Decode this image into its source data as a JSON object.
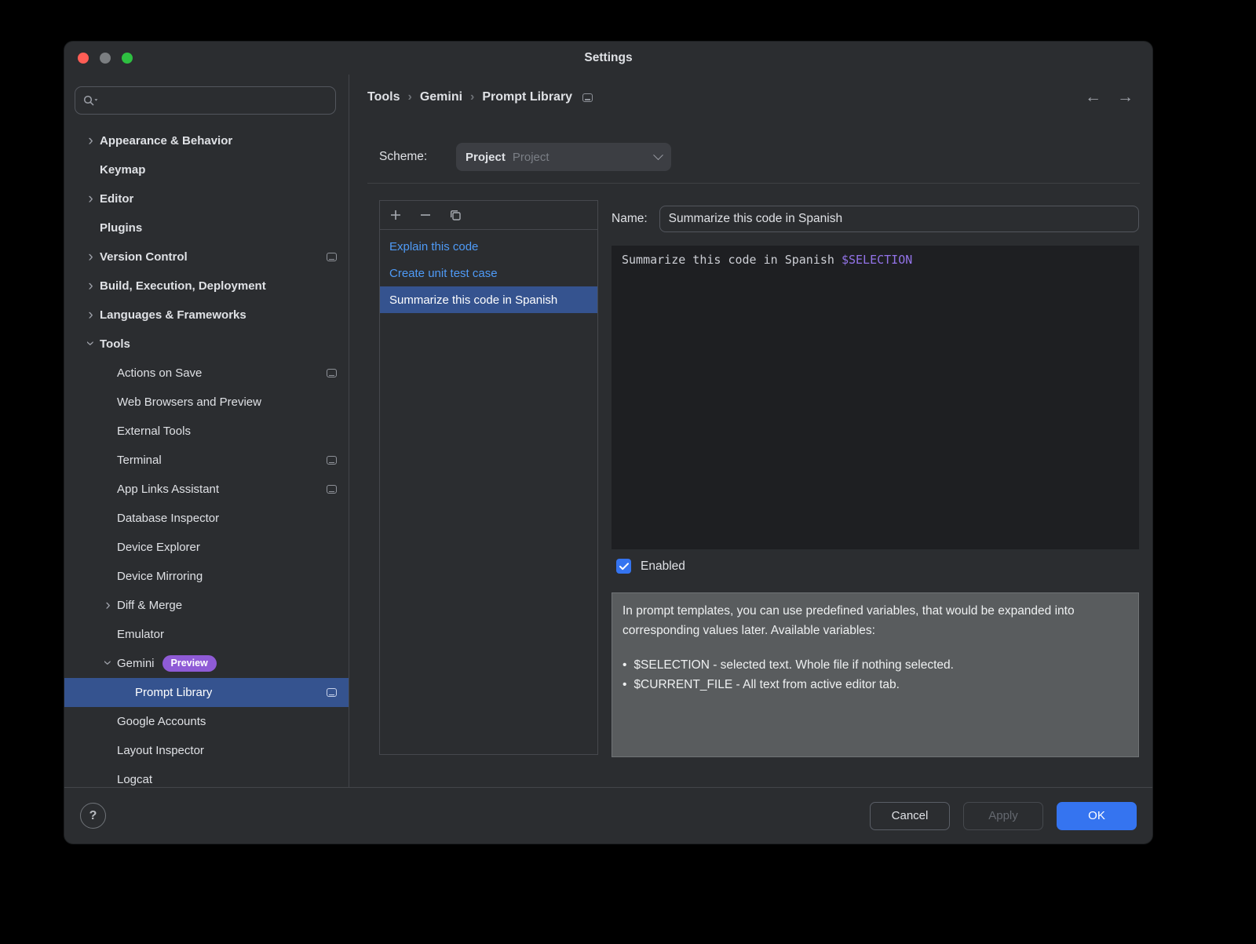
{
  "colors": {
    "accent": "#3574f0",
    "selection": "#35538f",
    "link": "#4f9bf7",
    "badge": "#8f5bd6",
    "variable": "#9373e8",
    "editor-bg": "#1e1f22",
    "info-bg": "#595c5e"
  },
  "window": {
    "title": "Settings"
  },
  "sidebar": {
    "search": {
      "placeholder": ""
    },
    "items": [
      {
        "label": "Appearance & Behavior",
        "level": 0,
        "chevron": "right",
        "bold": true
      },
      {
        "label": "Keymap",
        "level": 0,
        "bold": true
      },
      {
        "label": "Editor",
        "level": 0,
        "chevron": "right",
        "bold": true
      },
      {
        "label": "Plugins",
        "level": 0,
        "bold": true
      },
      {
        "label": "Version Control",
        "level": 0,
        "chevron": "right",
        "bold": true,
        "config_icon": true
      },
      {
        "label": "Build, Execution, Deployment",
        "level": 0,
        "chevron": "right",
        "bold": true
      },
      {
        "label": "Languages & Frameworks",
        "level": 0,
        "chevron": "right",
        "bold": true
      },
      {
        "label": "Tools",
        "level": 0,
        "chevron": "down",
        "bold": true
      },
      {
        "label": "Actions on Save",
        "level": 1,
        "config_icon": true
      },
      {
        "label": "Web Browsers and Preview",
        "level": 1
      },
      {
        "label": "External Tools",
        "level": 1
      },
      {
        "label": "Terminal",
        "level": 1,
        "config_icon": true
      },
      {
        "label": "App Links Assistant",
        "level": 1,
        "config_icon": true
      },
      {
        "label": "Database Inspector",
        "level": 1
      },
      {
        "label": "Device Explorer",
        "level": 1
      },
      {
        "label": "Device Mirroring",
        "level": 1
      },
      {
        "label": "Diff & Merge",
        "level": 1,
        "chevron": "right"
      },
      {
        "label": "Emulator",
        "level": 1
      },
      {
        "label": "Gemini",
        "level": 1,
        "chevron": "down",
        "badge": "Preview"
      },
      {
        "label": "Prompt Library",
        "level": 2,
        "selected": true,
        "config_icon": true
      },
      {
        "label": "Google Accounts",
        "level": 1
      },
      {
        "label": "Layout Inspector",
        "level": 1
      },
      {
        "label": "Logcat",
        "level": 1
      }
    ]
  },
  "breadcrumb": {
    "items": [
      "Tools",
      "Gemini",
      "Prompt Library"
    ],
    "separator": "›"
  },
  "scheme": {
    "label": "Scheme:",
    "value": "Project",
    "hint": "Project"
  },
  "prompt_list": {
    "items": [
      {
        "label": "Explain this code"
      },
      {
        "label": "Create unit test case"
      },
      {
        "label": "Summarize this code in Spanish",
        "selected": true
      }
    ]
  },
  "detail": {
    "name_label": "Name:",
    "name_value": "Summarize this code in Spanish",
    "editor_text": "Summarize this code in Spanish ",
    "editor_variable": "$SELECTION",
    "enabled_label": "Enabled",
    "info_intro": "In prompt templates, you can use predefined variables, that would be expanded into corresponding values later. Available variables:",
    "bullet_char": "•",
    "info_bullets": [
      "$SELECTION - selected text. Whole file if nothing selected.",
      "$CURRENT_FILE - All text from active editor tab."
    ]
  },
  "footer": {
    "help": "?",
    "cancel": "Cancel",
    "apply": "Apply",
    "ok": "OK"
  }
}
